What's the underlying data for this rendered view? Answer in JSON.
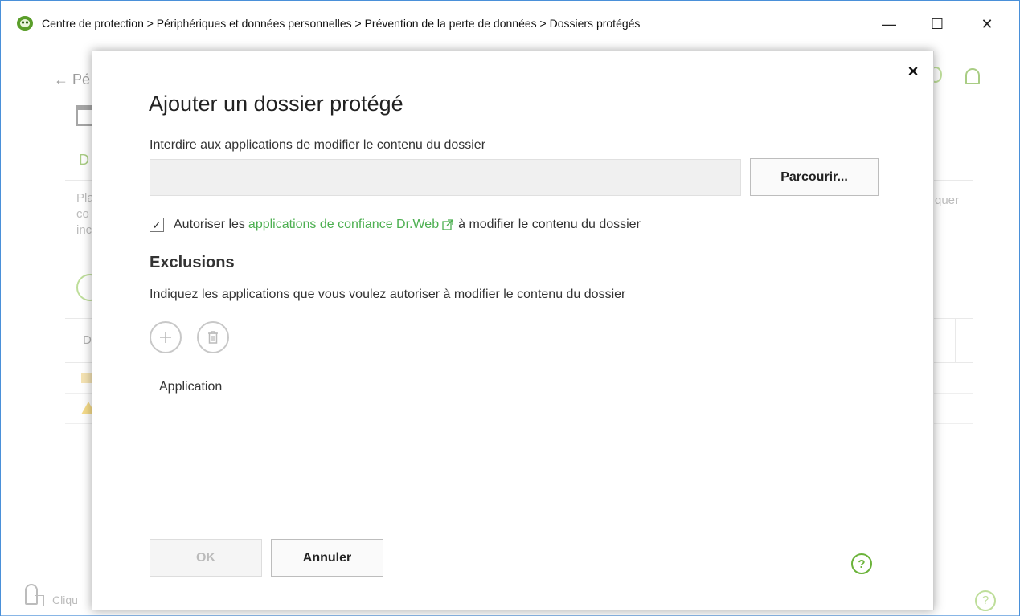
{
  "window": {
    "title": "Centre de protection > Périphériques et données personnelles > Prévention de la perte de données > Dossiers protégés",
    "minimize_symbol": "—",
    "maximize_symbol": "☐",
    "close_symbol": "✕"
  },
  "background": {
    "back_label": "← Pé",
    "tab_label": "D",
    "side_text_lines": [
      "Pla",
      "co",
      "inc"
    ],
    "right_text": "quer",
    "table_col": "D",
    "bottom_text": "Cliqu",
    "help_symbol": "?"
  },
  "dialog": {
    "close_symbol": "×",
    "title": "Ajouter un dossier protégé",
    "folder_label": "Interdire aux applications de modifier le contenu du dossier",
    "folder_value": "",
    "browse_label": "Parcourir...",
    "trusted": {
      "checked": true,
      "check_symbol": "✓",
      "prefix": "Autoriser les",
      "link_text": "applications de confiance Dr.Web",
      "suffix": "à modifier le contenu du dossier"
    },
    "exclusions_title": "Exclusions",
    "exclusions_desc": "Indiquez les applications que vous voulez autoriser à modifier le contenu du dossier",
    "table": {
      "columns": [
        "Application"
      ],
      "rows": []
    },
    "ok_label": "OK",
    "cancel_label": "Annuler",
    "help_symbol": "?"
  },
  "colors": {
    "accent_green": "#4caf50",
    "window_border": "#4a90d9"
  }
}
